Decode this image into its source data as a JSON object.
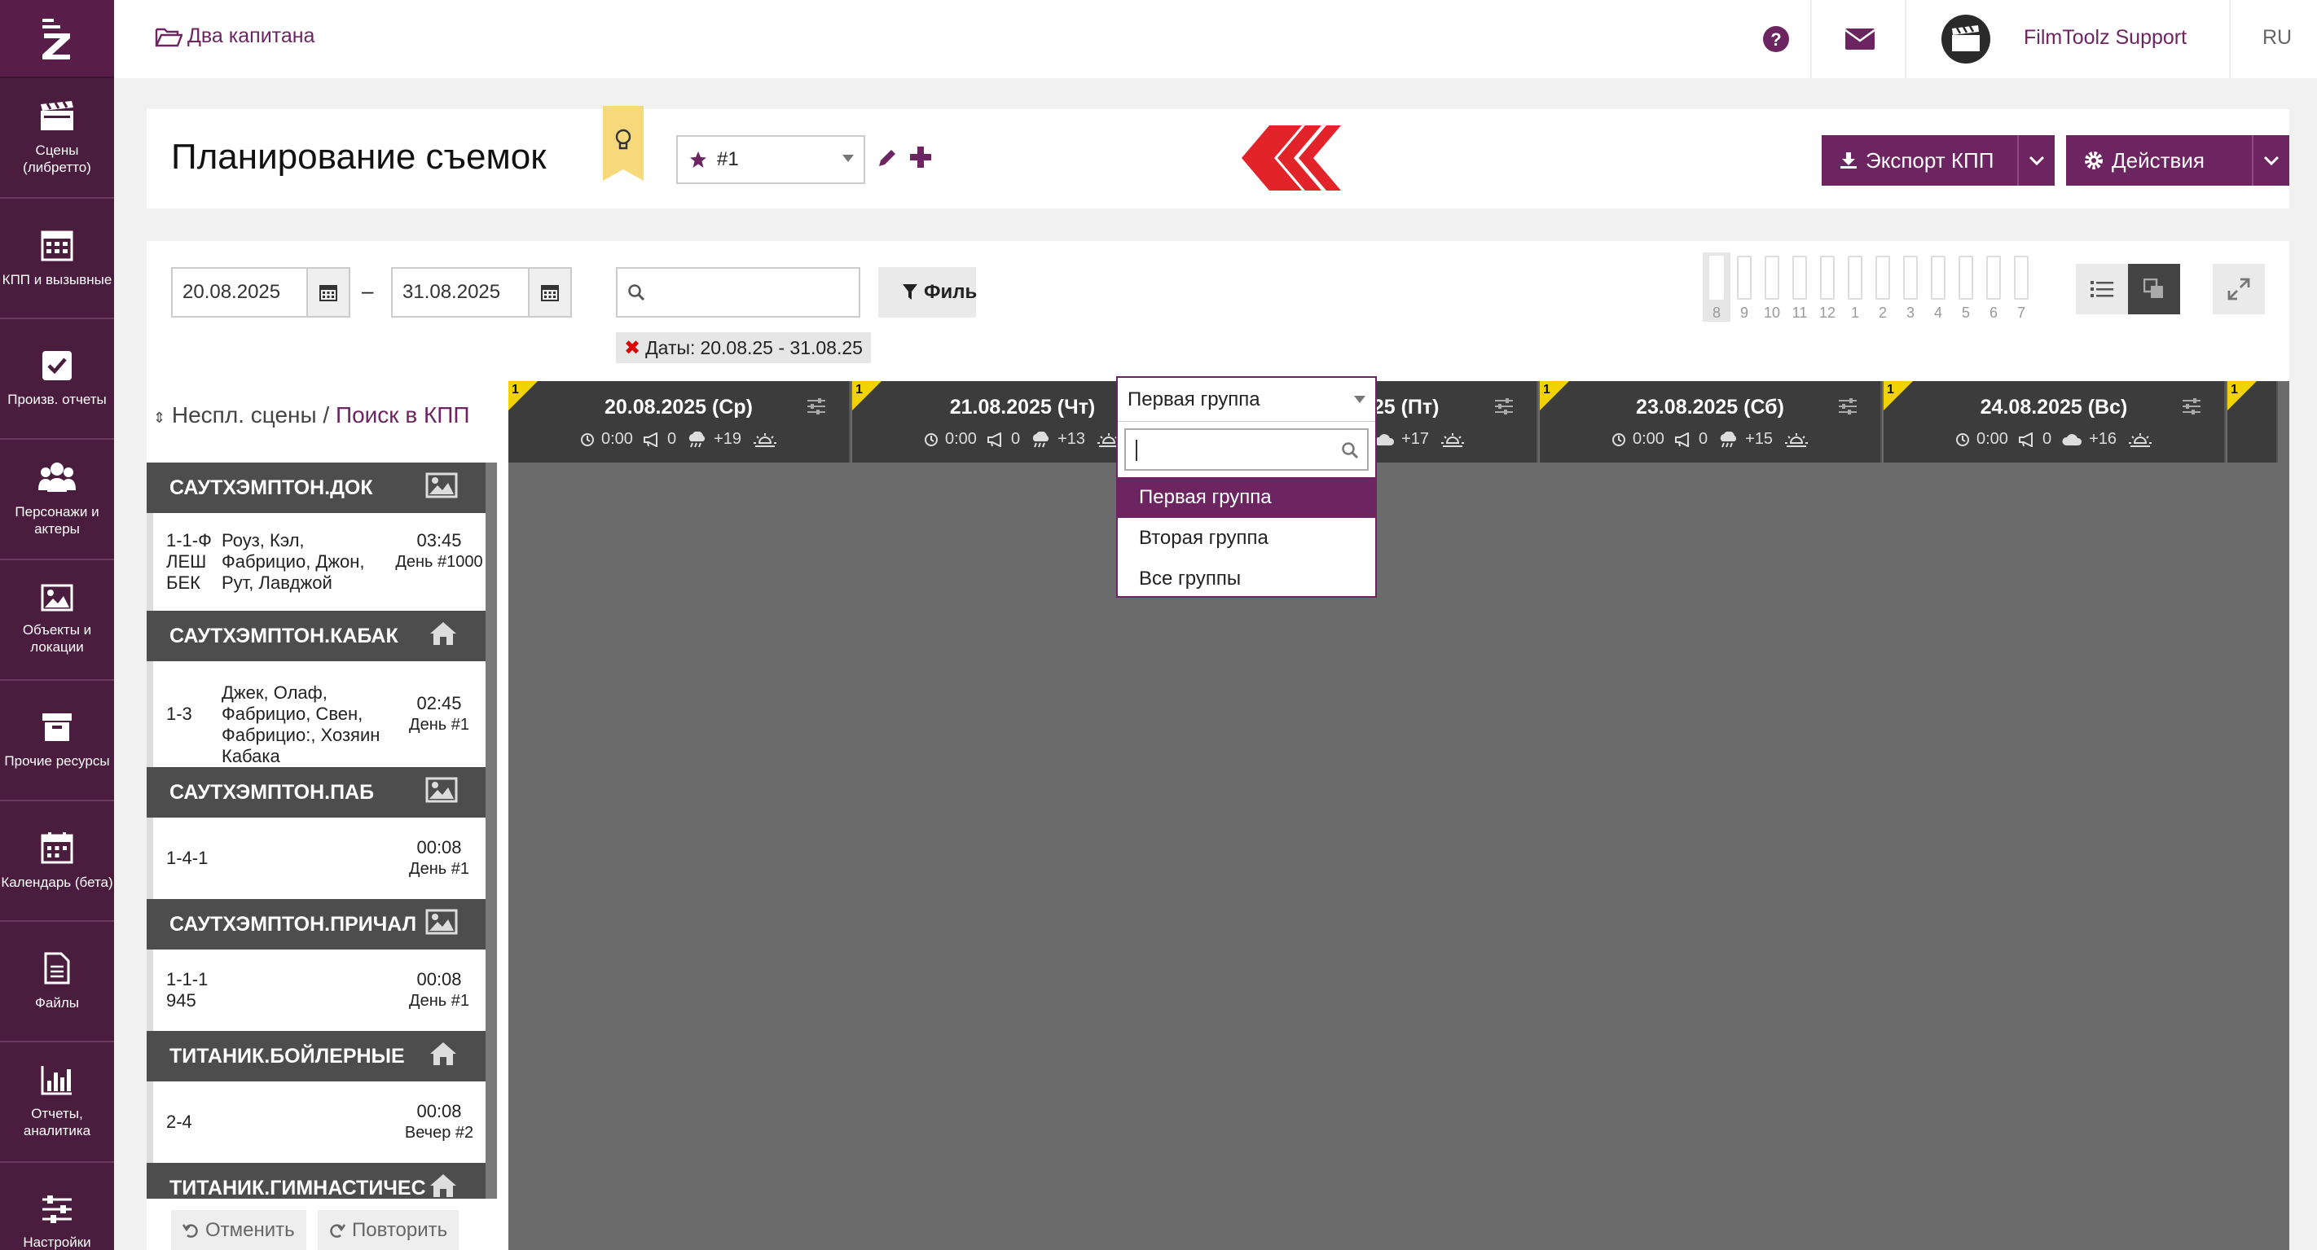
{
  "app": {
    "project": "Два капитана",
    "user": "FilmToolz Support",
    "language": "RU",
    "accent": "#6d2561",
    "sidebar_bg": "#4a1d3f"
  },
  "sidebar": {
    "items": [
      {
        "label": "Сцены (либретто)",
        "icon": "clapperboard-icon"
      },
      {
        "label": "КПП и вызывные",
        "icon": "calendar-grid-icon"
      },
      {
        "label": "Произв. отчеты",
        "icon": "checkbox-icon"
      },
      {
        "label": "Персонажи и актеры",
        "icon": "people-icon"
      },
      {
        "label": "Объекты и локации",
        "icon": "picture-icon"
      },
      {
        "label": "Прочие ресурсы",
        "icon": "box-icon"
      },
      {
        "label": "Календарь (бета)",
        "icon": "calendar-icon"
      },
      {
        "label": "Файлы",
        "icon": "file-icon"
      },
      {
        "label": "Отчеты, аналитика",
        "icon": "bar-chart-icon"
      },
      {
        "label": "Настройки",
        "icon": "sliders-icon"
      }
    ]
  },
  "header": {
    "title": "Планирование съемок",
    "variant": "#1",
    "group_selected": "Первая группа",
    "export_label": "Экспорт КПП",
    "actions_label": "Действия"
  },
  "group_dropdown": {
    "search_value": "",
    "options": [
      "Первая группа",
      "Вторая группа",
      "Все группы"
    ],
    "selected_index": 0
  },
  "filters": {
    "date_from": "20.08.2025",
    "date_sep": "–",
    "date_to": "31.08.2025",
    "search_value": "",
    "filter_label": "Филь",
    "tag_label": "Даты:",
    "tag_value": "20.08.25 - 31.08.25",
    "hours": [
      "8",
      "9",
      "10",
      "11",
      "12",
      "1",
      "2",
      "3",
      "4",
      "5",
      "6",
      "7"
    ]
  },
  "unscheduled": {
    "label": "Неспл. сцены",
    "sep": "/",
    "link": "Поиск в КПП"
  },
  "scenes": [
    {
      "location": "САУТХЭМПТОН.ДОК",
      "icon": "picture-icon",
      "items": [
        {
          "num": "1-1-Ф ЛЕШ БЕК",
          "cast": "Роуз, Кэл, Фабрицио, Джон, Рут, Лавджой",
          "time": "03:45",
          "day": "День #1000"
        }
      ]
    },
    {
      "location": "САУТХЭМПТОН.КАБАК",
      "icon": "house-icon",
      "items": [
        {
          "num": "1-3",
          "cast": "Джек, Олаф, Фабрицио, Свен, Фабрицио:, Хозяин Кабака",
          "time": "02:45",
          "day": "День #1"
        }
      ]
    },
    {
      "location": "САУТХЭМПТОН.ПАБ",
      "icon": "picture-icon",
      "items": [
        {
          "num": "1-4-1",
          "cast": "",
          "time": "00:08",
          "day": "День #1"
        }
      ]
    },
    {
      "location": "САУТХЭМПТОН.ПРИЧАЛ",
      "icon": "picture-icon",
      "items": [
        {
          "num": "1-1-1 945",
          "cast": "",
          "time": "00:08",
          "day": "День #1"
        }
      ]
    },
    {
      "location": "ТИТАНИК.БОЙЛЕРНЫЕ",
      "icon": "house-icon",
      "items": [
        {
          "num": "2-4",
          "cast": "",
          "time": "00:08",
          "day": "Вечер #2"
        }
      ]
    },
    {
      "location": "ТИТАНИК.ГИМНАСТИЧЕС",
      "icon": "house-icon",
      "items": []
    }
  ],
  "calendar": {
    "days": [
      {
        "flag": "1",
        "date": "20.08.2025 (Ср)",
        "time": "0:00",
        "scenes": "0",
        "temp": "+19",
        "weather": "rain"
      },
      {
        "flag": "1",
        "date": "21.08.2025 (Чт)",
        "time": "0:00",
        "scenes": "0",
        "temp": "+13",
        "weather": "rain"
      },
      {
        "flag": "1",
        "date": "22.08.2025 (Пт)",
        "time": "0:00",
        "scenes": "0",
        "temp": "+17",
        "weather": "cloud"
      },
      {
        "flag": "1",
        "date": "23.08.2025 (Сб)",
        "time": "0:00",
        "scenes": "0",
        "temp": "+15",
        "weather": "rain"
      },
      {
        "flag": "1",
        "date": "24.08.2025 (Вс)",
        "time": "0:00",
        "scenes": "0",
        "temp": "+16",
        "weather": "cloud"
      },
      {
        "flag": "1"
      }
    ]
  },
  "footer": {
    "undo": "Отменить",
    "redo": "Повторить"
  }
}
